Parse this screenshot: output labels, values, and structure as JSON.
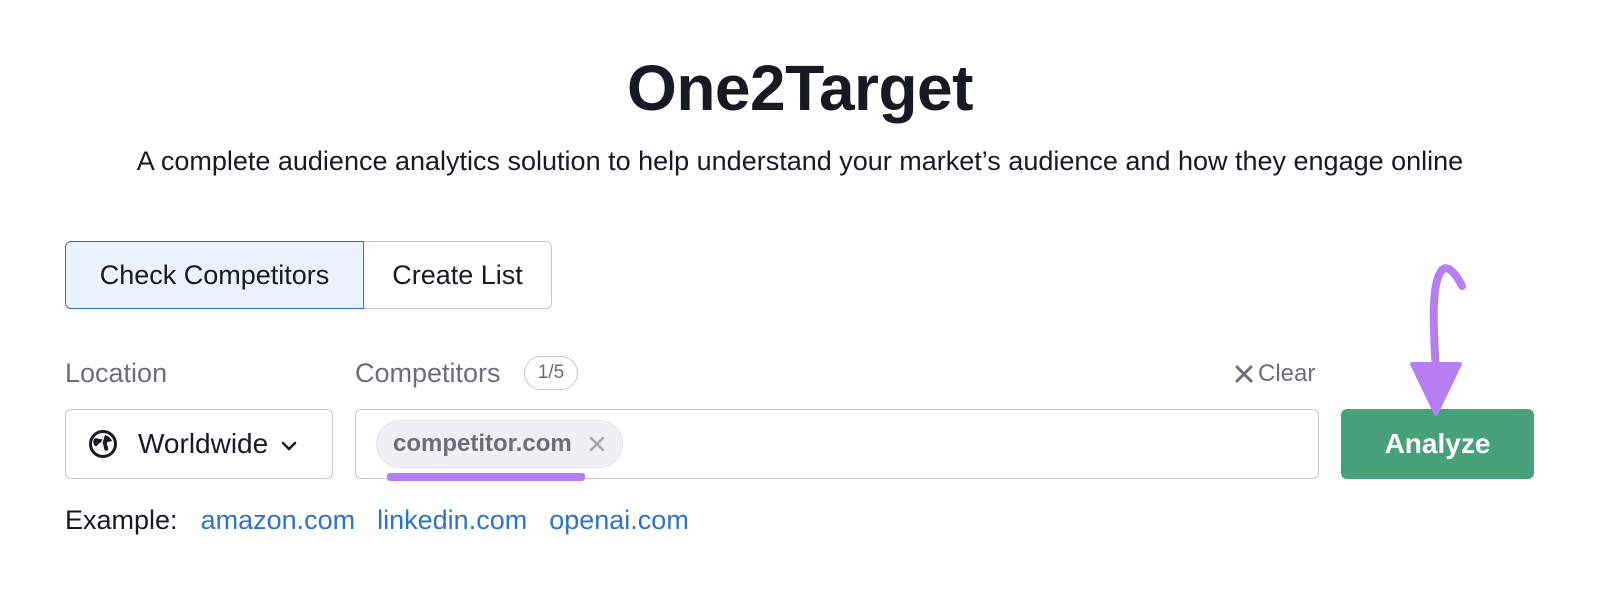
{
  "header": {
    "title": "One2Target",
    "subtitle": "A complete audience analytics solution to help understand your market’s audience and how they engage online"
  },
  "tabs": [
    {
      "label": "Check Competitors",
      "active": true
    },
    {
      "label": "Create List",
      "active": false
    }
  ],
  "location": {
    "label": "Location",
    "value": "Worldwide",
    "icon": "globe-icon"
  },
  "competitors": {
    "label": "Competitors",
    "count_badge": "1/5",
    "clear_label": "Clear",
    "chips": [
      {
        "value": "competitor.com"
      }
    ]
  },
  "actions": {
    "analyze_label": "Analyze"
  },
  "examples": {
    "label": "Example:",
    "links": [
      "amazon.com",
      "linkedin.com",
      "openai.com"
    ]
  },
  "colors": {
    "accent_blue": "#2d73c9",
    "analyze_green": "#47a27c",
    "annotation_purple": "#b77df3",
    "active_tab_bg": "#e9f2fd"
  }
}
